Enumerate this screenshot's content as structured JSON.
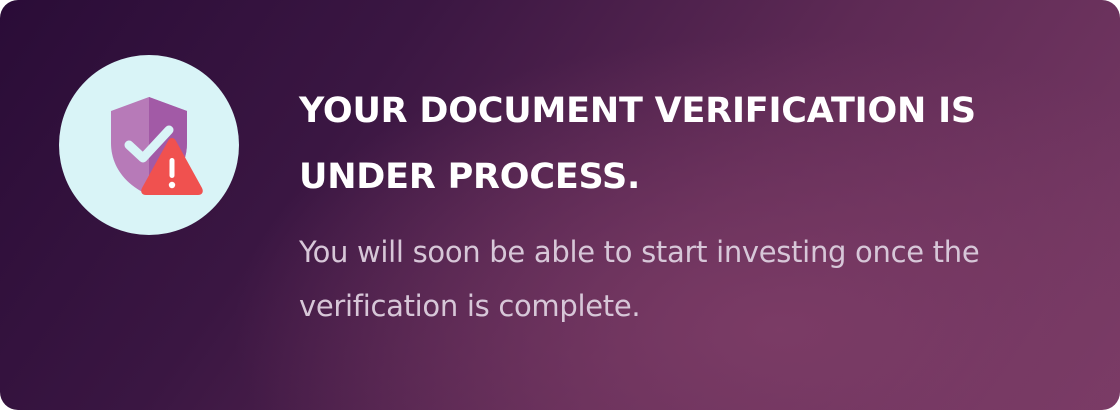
{
  "notification": {
    "title": "YOUR DOCUMENT VERIFICATION IS UNDER PROCESS.",
    "message": "You will soon be able to start investing once the verification is complete.",
    "icon": "shield-check-warning-icon",
    "colors": {
      "background_start": "#2a0c37",
      "background_end": "#7a3b66",
      "icon_circle": "#d9f4f7",
      "shield": "#b06cb4",
      "warning": "#f0514f",
      "text_primary": "#ffffff",
      "text_secondary": "#d7c7d8"
    }
  }
}
